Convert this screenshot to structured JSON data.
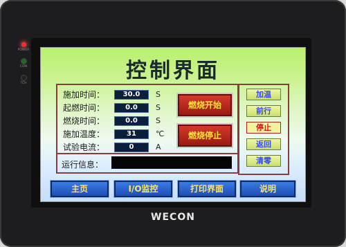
{
  "bezel": {
    "led_labels": [
      "POWER",
      "COM",
      "TCH"
    ],
    "brand": "WECON"
  },
  "screen": {
    "title": "控制界面",
    "params": [
      {
        "label": "施加时间：",
        "value": "30.0",
        "unit": "S"
      },
      {
        "label": "起燃时间：",
        "value": "0.0",
        "unit": "S"
      },
      {
        "label": "燃烧时间：",
        "value": "0.0",
        "unit": "S"
      },
      {
        "label": "施加温度：",
        "value": "31",
        "unit": "℃"
      },
      {
        "label": "试验电流：",
        "value": "0",
        "unit": "A"
      }
    ],
    "start_button": "燃烧开始",
    "stop_button": "燃烧停止",
    "side_buttons": [
      "加温",
      "前行",
      "停止",
      "返回",
      "清零"
    ],
    "info_label": "运行信息：",
    "info_text": "",
    "nav": [
      "主页",
      "I/O监控",
      "打印界面",
      "说明"
    ]
  }
}
